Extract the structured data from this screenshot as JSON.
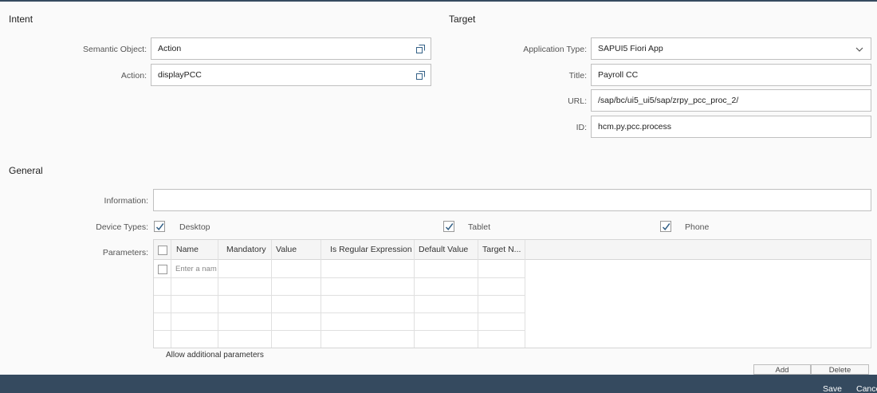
{
  "sections": {
    "intent": "Intent",
    "target": "Target",
    "general": "General"
  },
  "intent": {
    "semantic_object": {
      "label": "Semantic Object:",
      "value": "Action",
      "icon": "value-help-icon"
    },
    "action": {
      "label": "Action:",
      "value": "displayPCC",
      "icon": "value-help-icon"
    }
  },
  "target": {
    "application_type": {
      "label": "Application Type:",
      "value": "SAPUI5 Fiori App",
      "icon": "chevron-down-icon"
    },
    "title": {
      "label": "Title:",
      "value": "Payroll CC"
    },
    "url": {
      "label": "URL:",
      "value": "/sap/bc/ui5_ui5/sap/zrpy_pcc_proc_2/"
    },
    "id": {
      "label": "ID:",
      "value": "hcm.py.pcc.process"
    }
  },
  "general": {
    "information": {
      "label": "Information:",
      "value": ""
    },
    "device_types": {
      "label": "Device Types:",
      "desktop": {
        "label": "Desktop",
        "checked": true
      },
      "tablet": {
        "label": "Tablet",
        "checked": true
      },
      "phone": {
        "label": "Phone",
        "checked": true
      }
    },
    "parameters": {
      "label": "Parameters:",
      "columns": [
        "Name",
        "Mandatory",
        "Value",
        "Is Regular Expression",
        "Default Value",
        "Target N..."
      ],
      "name_placeholder": "Enter a nam",
      "allow_additional": "Allow additional parameters",
      "add_label": "Add",
      "delete_label": "Delete"
    }
  },
  "footer": {
    "save_label": "Save",
    "cancel_label": "Cance"
  },
  "colors": {
    "footer_bg": "#354a5f",
    "checkmark": "#346187"
  }
}
